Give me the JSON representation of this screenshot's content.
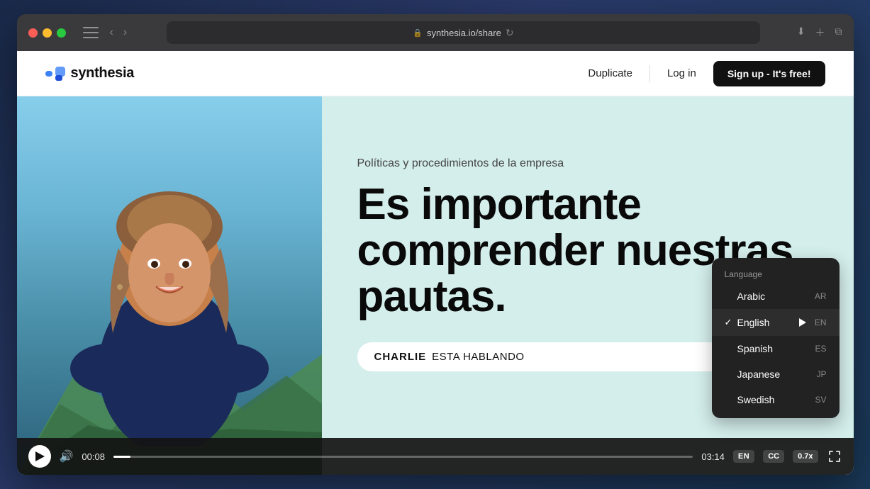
{
  "browser": {
    "url": "synthesia.io/share",
    "toolbar_icons": {
      "back": "‹",
      "forward": "›",
      "refresh": "↻",
      "add_tab": "+",
      "download": "⬇",
      "sidebar": "sidebar"
    }
  },
  "nav": {
    "logo_text": "synthesia",
    "duplicate_label": "Duplicate",
    "login_label": "Log in",
    "signup_label": "Sign up - It's free!"
  },
  "video": {
    "subtitle": "Políticas y procedimientos de la empresa",
    "main_title": "Es importante comprender nuestras pautas.",
    "speaker_name": "CHARLIE",
    "speaker_status": "ESTA HABLANDO",
    "time_current": "00:08",
    "time_total": "03:14",
    "lang_badge": "EN",
    "cc_badge": "CC",
    "speed_badge": "0.7x"
  },
  "language_dropdown": {
    "header": "Language",
    "items": [
      {
        "name": "Arabic",
        "code": "AR",
        "selected": false
      },
      {
        "name": "English",
        "code": "EN",
        "selected": true
      },
      {
        "name": "Spanish",
        "code": "ES",
        "selected": false
      },
      {
        "name": "Japanese",
        "code": "JP",
        "selected": false
      },
      {
        "name": "Swedish",
        "code": "SV",
        "selected": false
      }
    ]
  }
}
